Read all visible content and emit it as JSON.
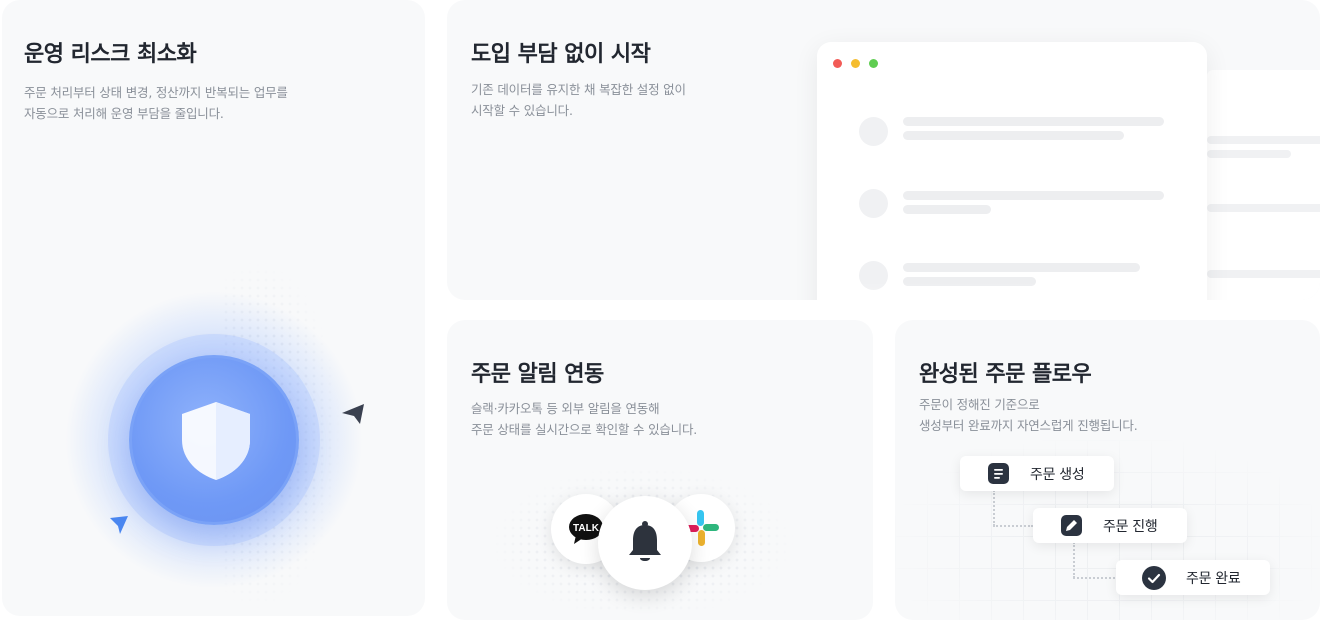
{
  "cards": {
    "risk": {
      "title": "운영 리스크 최소화",
      "desc_line1": "주문 처리부터 상태 변경, 정산까지 반복되는 업무를",
      "desc_line2": "자동으로 처리해 운영 부담을 줄입니다."
    },
    "start": {
      "title": "도입 부담 없이 시작",
      "desc_line1": "기존 데이터를 유지한 채 복잡한 설정 없이",
      "desc_line2": "시작할 수 있습니다."
    },
    "notify": {
      "title": "주문 알림 연동",
      "desc_line1": "슬랙·카카오톡 등 외부 알림을 연동해",
      "desc_line2": "주문 상태를 실시간으로 확인할 수 있습니다.",
      "apps": [
        "kakaotalk-icon",
        "bell-icon",
        "slack-icon"
      ],
      "kakao_badge": "TALK"
    },
    "flow": {
      "title": "완성된 주문 플로우",
      "desc_line1": "주문이 정해진 기준으로",
      "desc_line2": "생성부터 완료까지 자연스럽게 진행됩니다.",
      "steps": [
        {
          "label": "주문 생성",
          "icon": "document-icon"
        },
        {
          "label": "주문 진행",
          "icon": "pencil-icon"
        },
        {
          "label": "주문 완료",
          "icon": "check-icon"
        }
      ]
    }
  },
  "colors": {
    "accent_blue": "#6f99f6",
    "dark": "#2b3340",
    "traffic_red": "#f25b57",
    "traffic_yellow": "#f5bd2f",
    "traffic_green": "#5fcd51"
  }
}
